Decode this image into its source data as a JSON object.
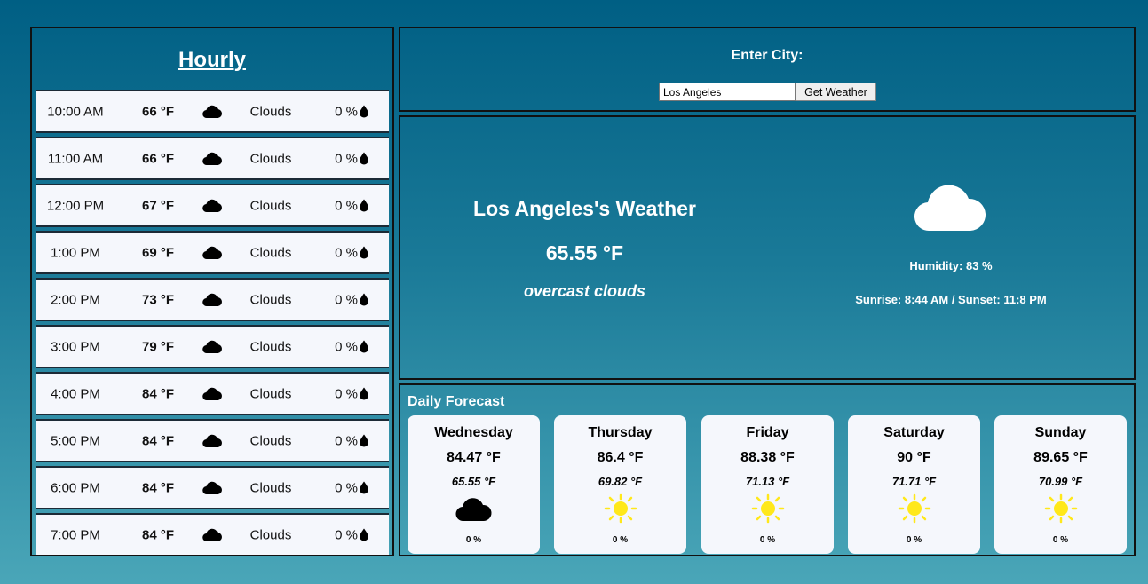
{
  "hourly": {
    "title": "Hourly",
    "rows": [
      {
        "time": "10:00 AM",
        "temp": "66 °F",
        "icon": "cloud-icon",
        "desc": "Clouds",
        "pop": "0 %"
      },
      {
        "time": "11:00 AM",
        "temp": "66 °F",
        "icon": "cloud-icon",
        "desc": "Clouds",
        "pop": "0 %"
      },
      {
        "time": "12:00 PM",
        "temp": "67 °F",
        "icon": "cloud-icon",
        "desc": "Clouds",
        "pop": "0 %"
      },
      {
        "time": "1:00 PM",
        "temp": "69 °F",
        "icon": "cloud-icon",
        "desc": "Clouds",
        "pop": "0 %"
      },
      {
        "time": "2:00 PM",
        "temp": "73 °F",
        "icon": "cloud-icon",
        "desc": "Clouds",
        "pop": "0 %"
      },
      {
        "time": "3:00 PM",
        "temp": "79 °F",
        "icon": "cloud-icon",
        "desc": "Clouds",
        "pop": "0 %"
      },
      {
        "time": "4:00 PM",
        "temp": "84 °F",
        "icon": "cloud-icon",
        "desc": "Clouds",
        "pop": "0 %"
      },
      {
        "time": "5:00 PM",
        "temp": "84 °F",
        "icon": "cloud-icon",
        "desc": "Clouds",
        "pop": "0 %"
      },
      {
        "time": "6:00 PM",
        "temp": "84 °F",
        "icon": "cloud-icon",
        "desc": "Clouds",
        "pop": "0 %"
      },
      {
        "time": "7:00 PM",
        "temp": "84 °F",
        "icon": "cloud-icon",
        "desc": "Clouds",
        "pop": "0 %"
      }
    ]
  },
  "search": {
    "label": "Enter City:",
    "value": "Los Angeles",
    "button_label": "Get Weather"
  },
  "current": {
    "city_title": "Los Angeles's Weather",
    "temp": "65.55 °F",
    "description": "overcast clouds",
    "icon": "cloud-icon",
    "humidity": "Humidity: 83 %",
    "sun_times": "Sunrise: 8:44 AM / Sunset: 11:8 PM"
  },
  "daily": {
    "title": "Daily Forecast",
    "days": [
      {
        "day": "Wednesday",
        "high": "84.47 °F",
        "low": "65.55 °F",
        "icon": "cloud-icon",
        "pop": "0 %"
      },
      {
        "day": "Thursday",
        "high": "86.4 °F",
        "low": "69.82 °F",
        "icon": "sun-icon",
        "pop": "0 %"
      },
      {
        "day": "Friday",
        "high": "88.38 °F",
        "low": "71.13 °F",
        "icon": "sun-icon",
        "pop": "0 %"
      },
      {
        "day": "Saturday",
        "high": "90 °F",
        "low": "71.71 °F",
        "icon": "sun-icon",
        "pop": "0 %"
      },
      {
        "day": "Sunday",
        "high": "89.65 °F",
        "low": "70.99 °F",
        "icon": "sun-icon",
        "pop": "0 %"
      }
    ]
  },
  "colors": {
    "background_top": "#005f84",
    "background_bottom": "#4aa6b8",
    "card": "#f5f7fc",
    "sun": "#ffe81a"
  }
}
